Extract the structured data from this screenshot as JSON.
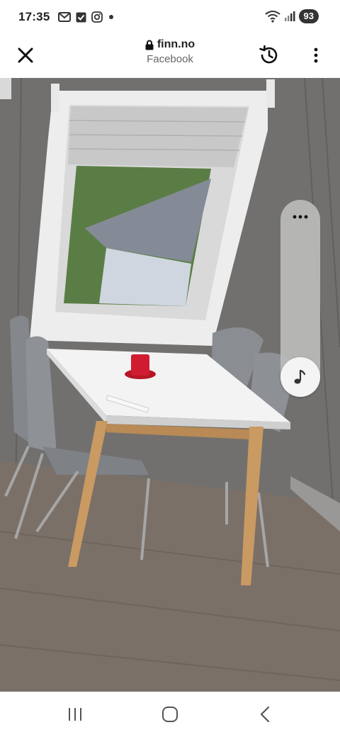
{
  "status_bar": {
    "time": "17:35",
    "notification_icons": [
      "gmail-icon",
      "checkbox-icon",
      "instagram-icon",
      "dot-icon"
    ],
    "battery": "93"
  },
  "browser": {
    "domain": "finn.no",
    "source": "Facebook",
    "icons": {
      "close": "close-icon",
      "lock": "lock-icon",
      "history": "history-icon",
      "more": "more-vertical-icon"
    }
  },
  "side_panel": {
    "icons": {
      "more": "more-horizontal-icon",
      "music": "music-note-icon"
    }
  },
  "nav_bar": {
    "icons": [
      "recent-apps-icon",
      "home-icon",
      "back-icon"
    ]
  },
  "colors": {
    "wall": "#6e6c6a",
    "floor": "#7a7068",
    "table_top": "#f2f2f2",
    "table_legs": "#c89a62",
    "chairs": "#8c8f94",
    "candle": "#c0182c"
  }
}
